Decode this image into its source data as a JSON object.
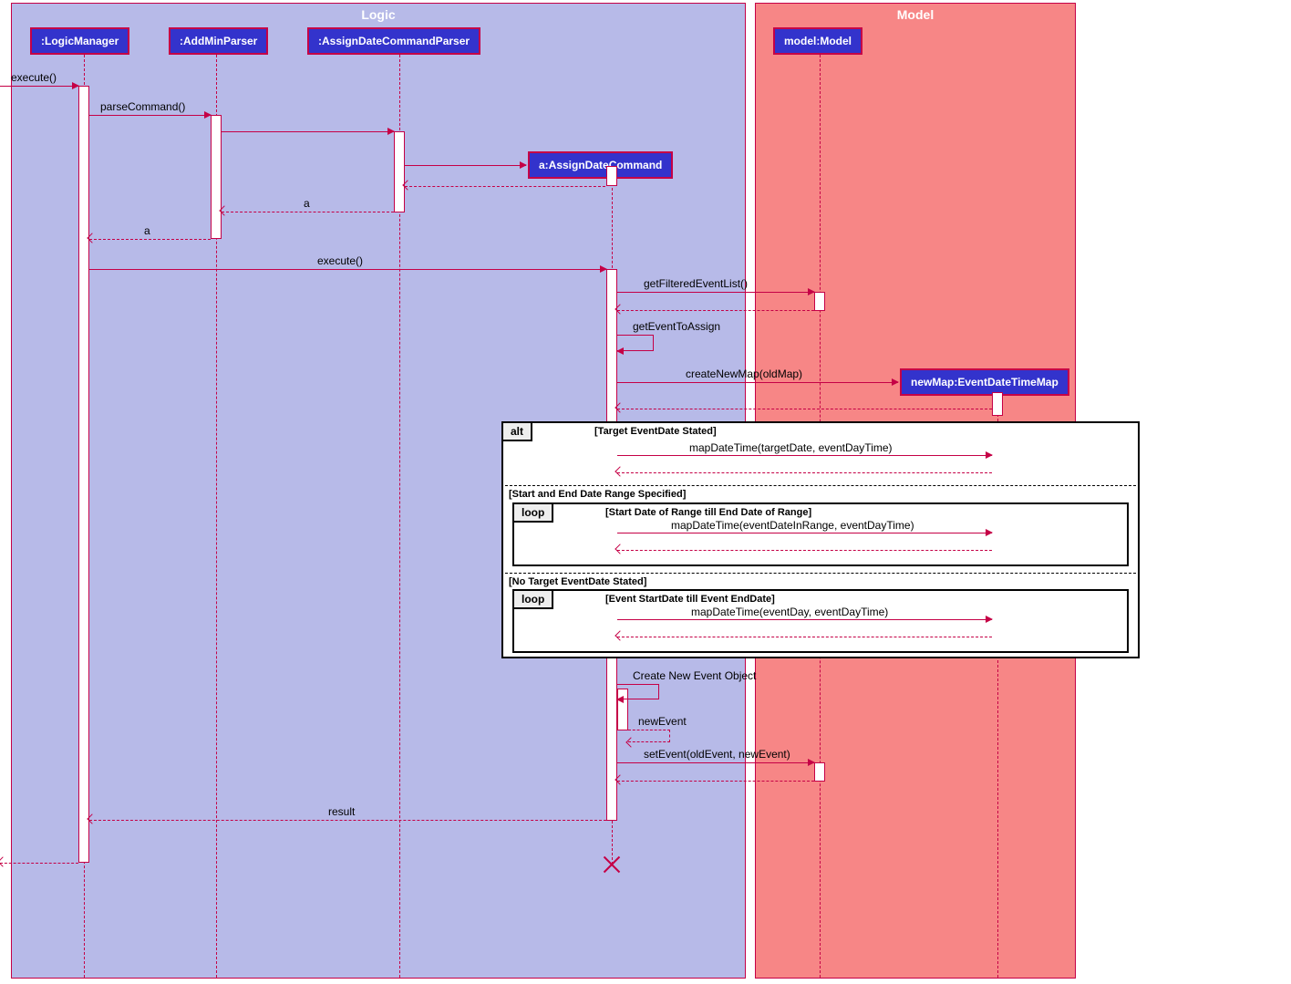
{
  "frames": {
    "logic": "Logic",
    "model": "Model"
  },
  "lifelines": {
    "logicManager": ":LogicManager",
    "addMinParser": ":AddMinParser",
    "assignDateCommandParser": ":AssignDateCommandParser",
    "assignDateCommand": "a:AssignDateCommand",
    "modelModel": "model:Model",
    "newMap": "newMap:EventDateTimeMap"
  },
  "messages": {
    "execute1": "execute()",
    "parseCommand": "parseCommand()",
    "returnA1": "a",
    "returnA2": "a",
    "execute2": "execute()",
    "getFilteredEventList": "getFilteredEventList()",
    "getEventToAssign": "getEventToAssign",
    "createNewMap": "createNewMap(oldMap)",
    "mapDateTime1": "mapDateTime(targetDate, eventDayTime)",
    "mapDateTime2": "mapDateTime(eventDateInRange, eventDayTime)",
    "mapDateTime3": "mapDateTime(eventDay, eventDayTime)",
    "createNewEvent": "Create New Event Object",
    "newEvent": "newEvent",
    "setEvent": "setEvent(oldEvent, newEvent)",
    "result": "result"
  },
  "fragments": {
    "alt": {
      "label": "alt",
      "cond1": "[Target EventDate Stated]",
      "cond2": "[Start and End Date Range Specified]",
      "cond3": "[No Target EventDate Stated]"
    },
    "loop1": {
      "label": "loop",
      "cond": "[Start Date of Range till End Date of Range]"
    },
    "loop2": {
      "label": "loop",
      "cond": "[Event StartDate till Event EndDate]"
    }
  }
}
